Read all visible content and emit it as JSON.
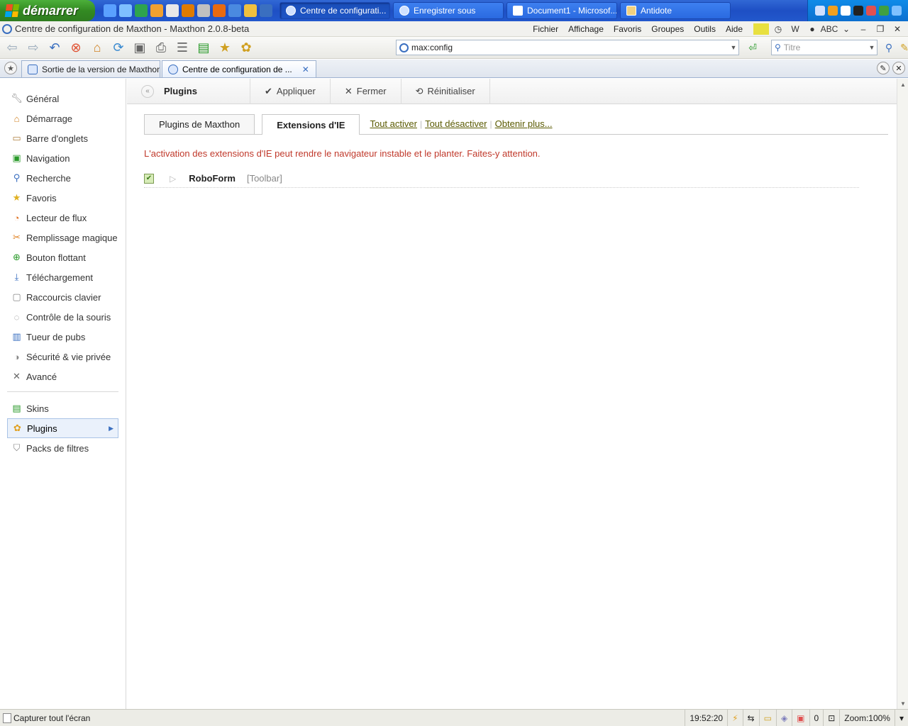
{
  "taskbar": {
    "start_label": "démarrer",
    "tasks": [
      {
        "label": "Centre de configurati..."
      },
      {
        "label": "Enregistrer sous"
      },
      {
        "label": "Document1 - Microsof..."
      },
      {
        "label": "Antidote"
      }
    ]
  },
  "window": {
    "title": "Centre de configuration de Maxthon - Maxthon 2.0.8-beta"
  },
  "menu": [
    "Fichier",
    "Affichage",
    "Favoris",
    "Groupes",
    "Outils",
    "Aide"
  ],
  "address": {
    "value": "max:config"
  },
  "search": {
    "placeholder": "Titre"
  },
  "tabs": [
    {
      "label": "Sortie de la version de Maxthon ..."
    },
    {
      "label": "Centre de configuration de ..."
    }
  ],
  "sidebar": {
    "items": [
      {
        "label": "Général",
        "icon": "wrench-icon"
      },
      {
        "label": "Démarrage",
        "icon": "home-icon"
      },
      {
        "label": "Barre d'onglets",
        "icon": "tabs-icon"
      },
      {
        "label": "Navigation",
        "icon": "navigation-icon"
      },
      {
        "label": "Recherche",
        "icon": "search-icon"
      },
      {
        "label": "Favoris",
        "icon": "star-icon"
      },
      {
        "label": "Lecteur de flux",
        "icon": "rss-icon"
      },
      {
        "label": "Remplissage magique",
        "icon": "magic-fill-icon"
      },
      {
        "label": "Bouton flottant",
        "icon": "plus-circle-icon"
      },
      {
        "label": "Téléchargement",
        "icon": "download-icon"
      },
      {
        "label": "Raccourcis clavier",
        "icon": "keyboard-icon"
      },
      {
        "label": "Contrôle de la souris",
        "icon": "mouse-icon"
      },
      {
        "label": "Tueur de pubs",
        "icon": "trash-icon"
      },
      {
        "label": "Sécurité & vie privée",
        "icon": "shield-icon"
      },
      {
        "label": "Avancé",
        "icon": "tools-icon"
      }
    ],
    "items2": [
      {
        "label": "Skins",
        "icon": "skin-icon"
      },
      {
        "label": "Plugins",
        "icon": "plugin-icon"
      },
      {
        "label": "Packs de filtres",
        "icon": "filter-icon"
      }
    ]
  },
  "content": {
    "title": "Plugins",
    "apply": "Appliquer",
    "close": "Fermer",
    "reset": "Réinitialiser",
    "tab_maxthon": "Plugins de Maxthon",
    "tab_ie": "Extensions d'IE",
    "enable_all": "Tout activer",
    "disable_all": "Tout désactiver",
    "get_more": "Obtenir plus...",
    "warning": "L'activation des extensions d'IE peut rendre le navigateur instable et le planter. Faites-y attention.",
    "plugins": [
      {
        "name": "RoboForm",
        "type": "[Toolbar]"
      }
    ]
  },
  "status": {
    "left": "Capturer tout l'écran",
    "time": "19:52:20",
    "count": "0",
    "zoom": "Zoom:100%"
  }
}
